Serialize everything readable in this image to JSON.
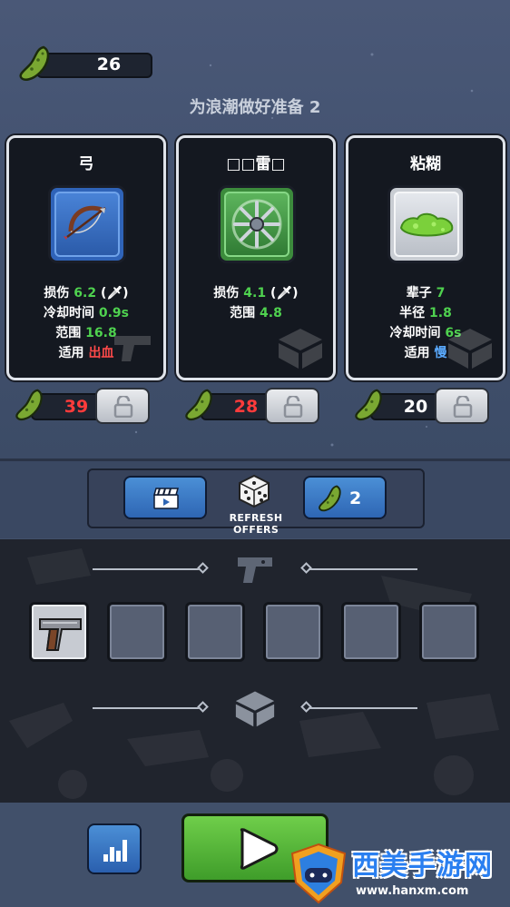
{
  "currency": {
    "amount": "26",
    "icon": "pickle-icon"
  },
  "wave_title": "为浪潮做好准备 2",
  "cards": [
    {
      "name": "弓",
      "icon": "bow-icon",
      "frame_color": "#2f63b8",
      "stats": [
        {
          "label": "损伤",
          "value": "6.2",
          "suffix": "(🗡)",
          "color": "green"
        },
        {
          "label": "冷却时间",
          "value": "0.9s",
          "color": "green"
        },
        {
          "label": "范围",
          "value": "16.8",
          "color": "green"
        },
        {
          "label": "适用",
          "value": "出血",
          "color": "red"
        }
      ],
      "price": "39",
      "price_color": "#ff3b3b"
    },
    {
      "name": "□□雷□",
      "icon": "shuriken-icon",
      "frame_color": "#3c8b3c",
      "stats": [
        {
          "label": "损伤",
          "value": "4.1",
          "suffix": "(🗡)",
          "color": "green"
        },
        {
          "label": "范围",
          "value": "4.8",
          "color": "green"
        }
      ],
      "price": "28",
      "price_color": "#ff3b3b"
    },
    {
      "name": "粘糊",
      "icon": "slime-icon",
      "frame_color": "#c9cdd3",
      "stats": [
        {
          "label": "辈子",
          "value": "7",
          "color": "green"
        },
        {
          "label": "半径",
          "value": "1.8",
          "color": "green"
        },
        {
          "label": "冷却时间",
          "value": "6s",
          "color": "green"
        },
        {
          "label": "适用",
          "value": "慢",
          "color": "blue"
        }
      ],
      "price": "20",
      "price_color": "#ffffff"
    }
  ],
  "refresh": {
    "label": "REFRESH OFFERS",
    "cost": "2",
    "video_icon": "clapperboard-icon",
    "dice_icon": "dice-icon"
  },
  "inventory": {
    "weapons_icon": "pistol-icon",
    "items_icon": "crate-icon",
    "slots": [
      "pistol",
      "",
      "",
      "",
      "",
      ""
    ]
  },
  "bottom": {
    "stats_icon": "bar-chart-icon",
    "play_icon": "play-icon"
  },
  "watermark": {
    "title": "西美手游网",
    "url": "www.hanxm.com"
  }
}
